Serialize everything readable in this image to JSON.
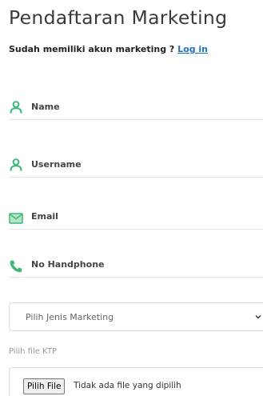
{
  "header": {
    "title": "Pendaftaran Marketing",
    "subtitle_prefix": "Sudah memiliki akun marketing ? ",
    "login_link": "Log in"
  },
  "form": {
    "name_placeholder": "Name",
    "username_placeholder": "Username",
    "email_placeholder": "Email",
    "phone_placeholder": "No Handphone",
    "marketing_type_select": "Pilih Jenis Marketing",
    "ktp_label": "Pilih file KTP",
    "file_button": "Pilih File",
    "file_status": "Tidak ada file yang dipilih"
  },
  "icons": {
    "name": "user-icon",
    "username": "user-icon",
    "email": "envelope-icon",
    "phone": "phone-icon",
    "select": "chevron-down-icon"
  },
  "colors": {
    "accent": "#3cb878",
    "link": "#1a73c8"
  }
}
